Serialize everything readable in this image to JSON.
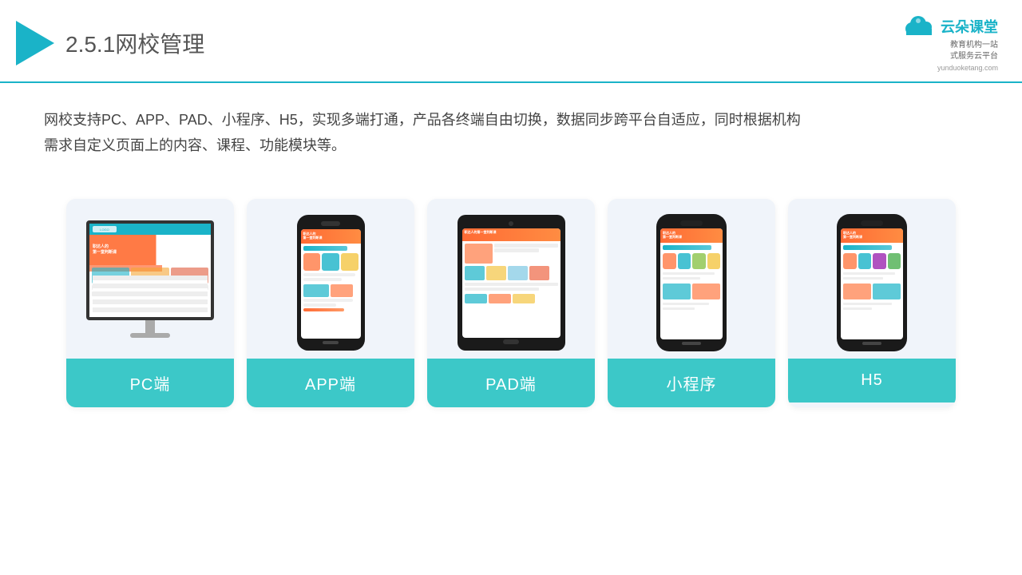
{
  "header": {
    "section": "2.5.1",
    "title": "网校管理",
    "brand_name": "云朵课堂",
    "brand_domain": "yunduoketang.com",
    "brand_tagline_line1": "教育机构一站",
    "brand_tagline_line2": "式服务云平台"
  },
  "description": {
    "text_line1": "网校支持PC、APP、PAD、小程序、H5，实现多端打通，产品各终端自由切换，数据同步跨平台自适应，同时根据机构",
    "text_line2": "需求自定义页面上的内容、课程、功能模块等。"
  },
  "cards": [
    {
      "id": "pc",
      "label": "PC端"
    },
    {
      "id": "app",
      "label": "APP端"
    },
    {
      "id": "pad",
      "label": "PAD端"
    },
    {
      "id": "miniprogram",
      "label": "小程序"
    },
    {
      "id": "h5",
      "label": "H5"
    }
  ],
  "colors": {
    "teal": "#3cc8c8",
    "header_line": "#1ab3c8",
    "triangle": "#1ab3c8",
    "text_dark": "#333",
    "text_mid": "#444",
    "card_bg": "#eef2f8"
  }
}
